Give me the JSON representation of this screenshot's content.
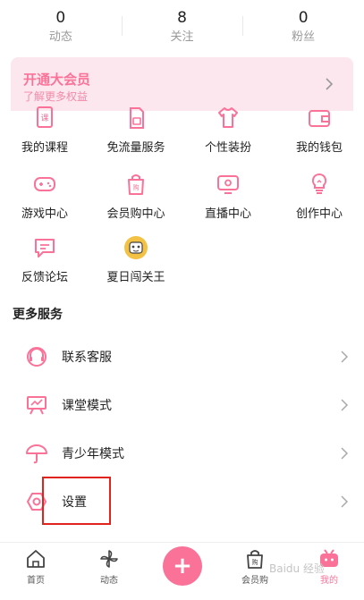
{
  "stats": [
    {
      "value": "0",
      "label": "动态"
    },
    {
      "value": "8",
      "label": "关注"
    },
    {
      "value": "0",
      "label": "粉丝"
    }
  ],
  "vip": {
    "title": "开通大会员",
    "subtitle": "了解更多权益"
  },
  "grid": [
    {
      "label": "我的课程",
      "icon": "course-icon"
    },
    {
      "label": "免流量服务",
      "icon": "sim-card-icon"
    },
    {
      "label": "个性装扮",
      "icon": "tshirt-icon"
    },
    {
      "label": "我的钱包",
      "icon": "wallet-icon"
    },
    {
      "label": "游戏中心",
      "icon": "gamepad-icon"
    },
    {
      "label": "会员购中心",
      "icon": "shopping-bag-icon"
    },
    {
      "label": "直播中心",
      "icon": "tv-icon"
    },
    {
      "label": "创作中心",
      "icon": "lightbulb-icon"
    },
    {
      "label": "反馈论坛",
      "icon": "chat-bubble-icon"
    },
    {
      "label": "夏日闯关王",
      "icon": "summer-event-icon"
    }
  ],
  "more_services_title": "更多服务",
  "services": [
    {
      "label": "联系客服",
      "icon": "headset-icon"
    },
    {
      "label": "课堂模式",
      "icon": "classroom-board-icon"
    },
    {
      "label": "青少年模式",
      "icon": "umbrella-icon"
    },
    {
      "label": "设置",
      "icon": "settings-gear-icon"
    }
  ],
  "tabbar": [
    {
      "label": "首页",
      "icon": "home-icon"
    },
    {
      "label": "动态",
      "icon": "pinwheel-icon"
    },
    {
      "label": "会员购",
      "icon": "shopping-bag-icon"
    },
    {
      "label": "我的",
      "icon": "tv-mascot-icon"
    }
  ],
  "publish_symbol": "+",
  "watermark": "Baidu 经验",
  "colors": {
    "accent": "#fb7299",
    "vip_bg": "#fde7ee",
    "highlight_box": "#e0231c"
  }
}
